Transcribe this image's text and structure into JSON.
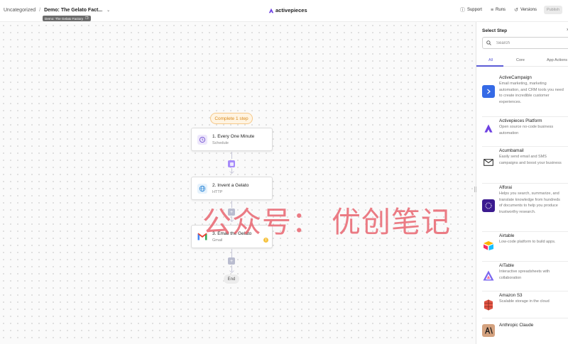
{
  "header": {
    "folder": "Uncategorized",
    "separator": "/",
    "flow_name": "Demo: The Gelato Fact...",
    "tooltip": "Demo: The Gelato Factory",
    "logo_text": "activepieces",
    "support": "Support",
    "runs": "Runs",
    "versions": "Versions",
    "publish": "Publish"
  },
  "canvas": {
    "complete_badge": "Complete 1 step",
    "steps": [
      {
        "title": "1. Every One Minute",
        "subtitle": "Schedule",
        "icon": "clock-icon"
      },
      {
        "title": "2. Invent a Gelato",
        "subtitle": "HTTP",
        "icon": "globe-icon"
      },
      {
        "title": "3. Email the Gelato",
        "subtitle": "Gmail",
        "icon": "gmail-icon",
        "warning": "!"
      }
    ],
    "end_label": "End",
    "watermark": "公众号： 优创笔记"
  },
  "sidebar": {
    "title": "Select Step",
    "close": "×",
    "search_placeholder": "Search",
    "tabs": [
      "All",
      "Core",
      "App Actions"
    ],
    "active_tab": "All",
    "items": [
      {
        "name": "ActiveCampaign",
        "description": "Email marketing, marketing automation, and CRM tools you need to create incredible customer experiences.",
        "icon": "activecampaign-icon",
        "color": "#356ae6"
      },
      {
        "name": "Activepieces Platform",
        "description": "Open source no-code business automation",
        "icon": "activepieces-icon",
        "color": "#6e41e2"
      },
      {
        "name": "Acumbamail",
        "description": "Easily send email and SMS campaigns and boost your business",
        "icon": "mail-icon",
        "color": "#222222"
      },
      {
        "name": "Afforai",
        "description": "Helps you search, summarize, and translate knowledge from hundreds of documents to help you produce trustworthy research.",
        "icon": "afforai-icon",
        "color": "#3b1a8f"
      },
      {
        "name": "Airtable",
        "description": "Low-code platform to build apps.",
        "icon": "airtable-icon",
        "color": "#fcb400"
      },
      {
        "name": "AITable",
        "description": "Interactive spreadsheets with collaboration",
        "icon": "aitable-icon",
        "color": "#7b67ee"
      },
      {
        "name": "Amazon S3",
        "description": "Scalable storage in the cloud",
        "icon": "s3-icon",
        "color": "#e25444"
      },
      {
        "name": "Anthropic Claude",
        "description": "",
        "icon": "anthropic-icon",
        "color": "#d4a27f"
      }
    ]
  }
}
